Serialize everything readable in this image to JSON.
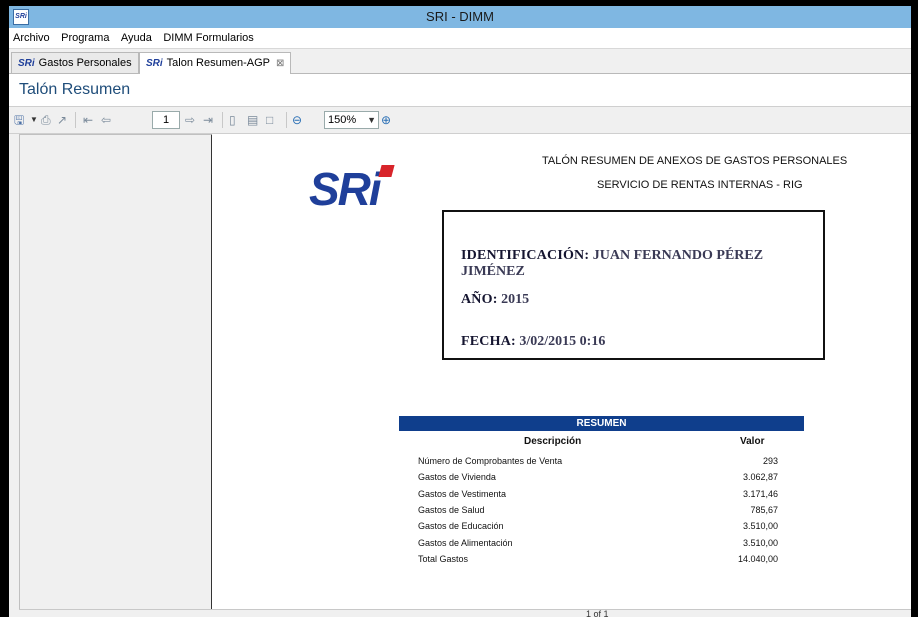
{
  "window": {
    "app_icon": "SRi",
    "title": "SRI - DIMM"
  },
  "menubar": {
    "items": [
      "Archivo",
      "Programa",
      "Ayuda",
      "DIMM Formularios"
    ]
  },
  "tabs": [
    {
      "icon": "SRi",
      "label": "Gastos Personales",
      "active": false
    },
    {
      "icon": "SRi",
      "label": "Talon Resumen-AGP",
      "active": true,
      "close": "⊠"
    }
  ],
  "page_title": "Talón Resumen",
  "toolbar": {
    "page": "1",
    "zoom": "150%",
    "icons": [
      "save-icon",
      "dropdown-arrow-icon",
      "print-icon",
      "export-icon",
      "first-page-icon",
      "previous-page-icon",
      "next-page-icon",
      "last-page-icon",
      "single-page-icon",
      "fit-page-icon",
      "fit-width-icon",
      "zoom-out-icon",
      "zoom-in-icon"
    ]
  },
  "report": {
    "logo_text": "SRi",
    "heading1": "TALÓN RESUMEN DE ANEXOS DE GASTOS PERSONALES",
    "heading2": "SERVICIO DE RENTAS INTERNAS - RIG",
    "info": {
      "id_label": "IDENTIFICACIÓN:",
      "id_value": "JUAN FERNANDO PÉREZ JIMÉNEZ",
      "year_label": "AÑO:",
      "year_value": "2015",
      "date_label": "FECHA:",
      "date_value": "3/02/2015 0:16"
    },
    "resumen": {
      "band": "RESUMEN",
      "col_desc": "Descripción",
      "col_val": "Valor",
      "rows": [
        {
          "desc": "Número de Comprobantes de Venta",
          "value": "293"
        },
        {
          "desc": "Gastos de Vivienda",
          "value": "3.062,87"
        },
        {
          "desc": "Gastos de Vestimenta",
          "value": "3.171,46"
        },
        {
          "desc": "Gastos de Salud",
          "value": "785,67"
        },
        {
          "desc": "Gastos de Educación",
          "value": "3.510,00"
        },
        {
          "desc": "Gastos de Alimentación",
          "value": "3.510,00"
        },
        {
          "desc": "Total Gastos",
          "value": "14.040,00"
        }
      ]
    }
  },
  "status": {
    "page_indicator": "1 of 1"
  },
  "colors": {
    "titlebar": "#7fb7e2",
    "brand_blue": "#1f3f9a",
    "band_blue": "#0f3e8c",
    "logo_red": "#d8242a"
  }
}
